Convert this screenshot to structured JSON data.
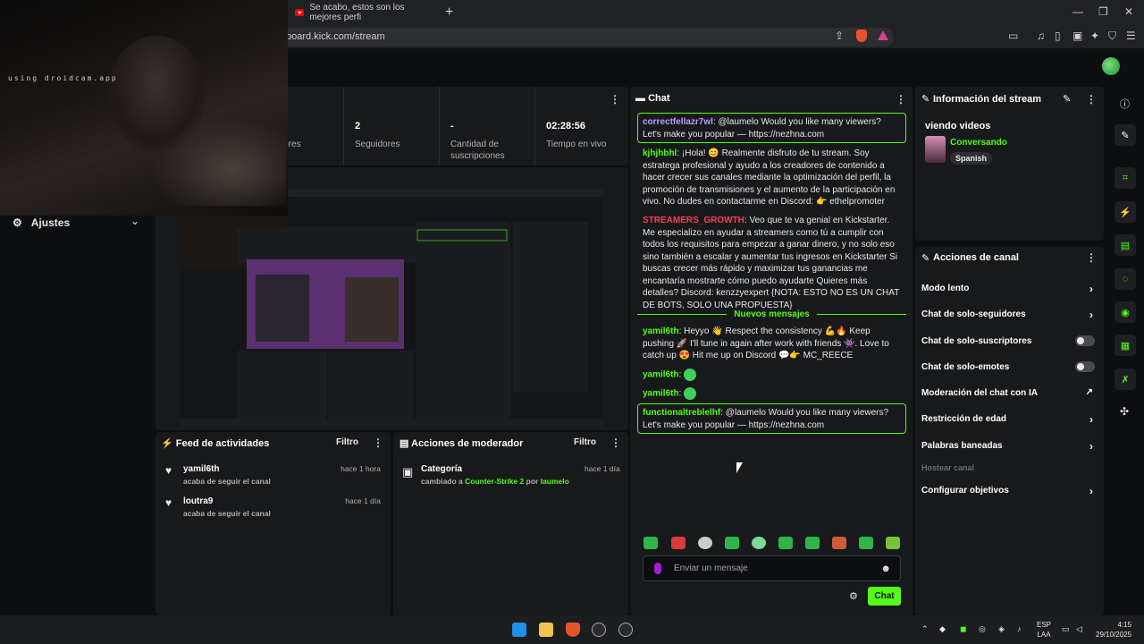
{
  "browser": {
    "tab_title": "Se acabo, estos son los mejores perfi",
    "url": "board.kick.com/stream",
    "new_tab": "+",
    "minimize": "—",
    "maximize": "❐",
    "close": "✕"
  },
  "webcam": {
    "label": "using droidcam.app"
  },
  "sidebar": {
    "ajustes_label": "Ajustes"
  },
  "stats": [
    {
      "value": "",
      "label": "adores"
    },
    {
      "value": "2",
      "label": "Seguidores"
    },
    {
      "value": "-",
      "label": "Cantidad de suscripciones"
    },
    {
      "value": "02:28:56",
      "label": "Tiempo en vivo"
    }
  ],
  "feed": {
    "title": "Feed de actividades",
    "filter": "Filtro",
    "items": [
      {
        "name": "yamil6th",
        "sub": "acaba de seguir el canal",
        "time": "hace 1 hora"
      },
      {
        "name": "loutra9",
        "sub": "acaba de seguir el canal",
        "time": "hace 1 día"
      }
    ]
  },
  "mod": {
    "title": "Acciones de moderador",
    "filter": "Filtro",
    "item": {
      "name": "Categoría",
      "time": "hace 1 día",
      "prefix": "cambiado a ",
      "game": "Counter-Strike 2",
      "mid": " por ",
      "by": "laumelo"
    }
  },
  "chat": {
    "title": "Chat",
    "messages": [
      {
        "user": "correctfellazr7wl",
        "color": "#b79cff",
        "text": ": @laumelo Would you like many viewers? Let's make you popular — https://nezhna.com"
      },
      {
        "user": "kjhjhbhl",
        "color": "#53fc18",
        "text": ": ¡Hola! 😊 Realmente disfruto de tu stream. Soy estratega profesional y ayudo a los creadores de contenido a hacer crecer sus canales mediante la optimización del perfil, la promoción de transmisiones y el aumento de la participación en vivo. No dudes en contactarme en Discord: 👉 ethelpromoter"
      },
      {
        "user": "STREAMERS_GROWTH",
        "color": "#ff3b4e",
        "text": ": Veo que te va genial en Kickstarter. Me especializo en ayudar a streamers como tú a cumplir con todos los requisitos para empezar a ganar dinero, y no solo eso sino también a escalar y aumentar tus ingresos en Kickstarter Si buscas crecer más rápido y maximizar tus ganancias me encantaría mostrarte cómo puedo ayudarte Quieres más detalles? Discord: kenzzyexpert {NOTA: ESTO NO ES UN CHAT DE BOTS, SOLO UNA PROPUESTA}"
      },
      {
        "user": "yamil6th",
        "color": "#53fc18",
        "text": ": Heyyo 👋 Respect the consistency 💪🔥 Keep pushing 🚀 I'll tune in again after work with friends 👾. Love to catch up 😍 Hit me up on Discord 💬👉 MC_REECE"
      },
      {
        "user": "yamil6th",
        "color": "#53fc18",
        "text": ":"
      },
      {
        "user": "yamil6th",
        "color": "#53fc18",
        "text": ":"
      },
      {
        "user": "functionaltreblelhf",
        "color": "#53fc18",
        "text": ": @laumelo Would you like many viewers? Let's make you popular — https://nezhna.com"
      }
    ],
    "new_messages": "Nuevos mensajes",
    "input_placeholder": "Enviar un mensaje",
    "send_label": "Chat"
  },
  "info": {
    "title": "Información del stream",
    "stream_title": "viendo videos",
    "category": "Conversando",
    "language": "Spanish"
  },
  "actions": {
    "title": "Acciones de canal",
    "items": [
      {
        "label": "Modo lento",
        "kind": "arrow"
      },
      {
        "label": "Chat de solo-seguidores",
        "kind": "arrow"
      },
      {
        "label": "Chat de solo-suscriptores",
        "kind": "toggle"
      },
      {
        "label": "Chat de solo-emotes",
        "kind": "toggle"
      },
      {
        "label": "Moderación del chat con IA",
        "kind": "external"
      },
      {
        "label": "Restricción de edad",
        "kind": "arrow"
      },
      {
        "label": "Palabras baneadas",
        "kind": "arrow"
      },
      {
        "label": "Hostear canal",
        "kind": "disabled"
      },
      {
        "label": "Configurar objetivos",
        "kind": "arrow"
      }
    ]
  },
  "taskbar": {
    "lang_top": "ESP",
    "lang_bottom": "LAA",
    "time": "4:15",
    "date": "29/10/2025"
  },
  "colors": {
    "accent": "#53fc18",
    "panel": "#18191b",
    "bg": "#0d0e10"
  }
}
